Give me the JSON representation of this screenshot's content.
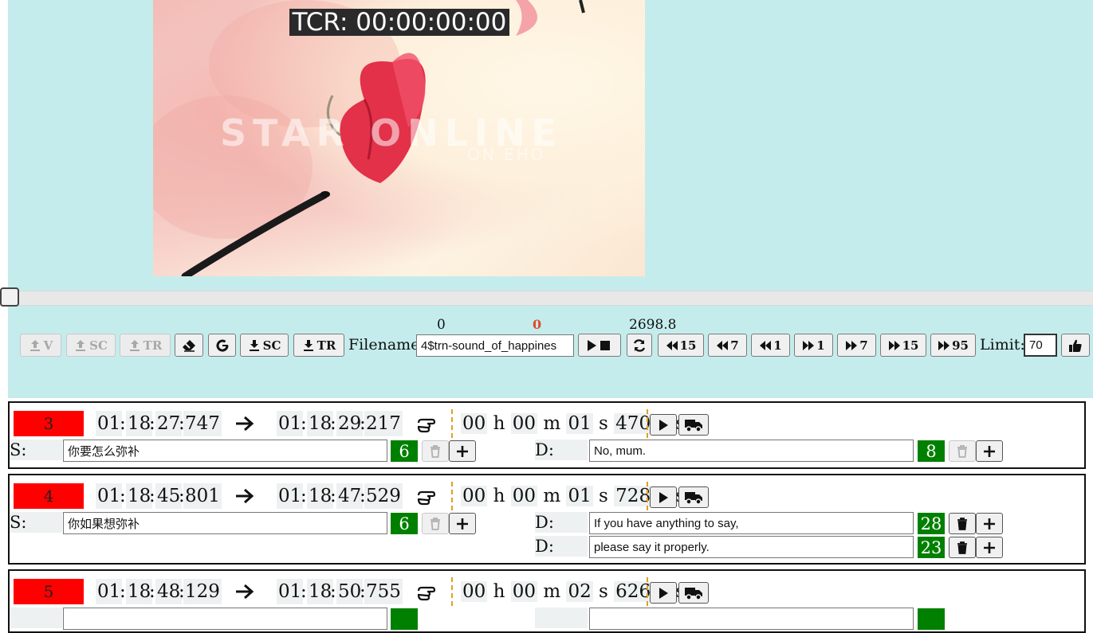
{
  "video": {
    "tcr": "TCR: 00:00:00:00",
    "watermark": "STAR ONLINE",
    "watermark_sub": "ON EHO"
  },
  "positions": {
    "start": "0",
    "current": "0",
    "end": "2698.8"
  },
  "toolbar": {
    "upload_v": "V",
    "upload_sc": "SC",
    "upload_tr": "TR",
    "download_sc": "SC",
    "download_tr": "TR",
    "filename_label": "Filename:",
    "filename_value": "4$trn-sound_of_happines",
    "rew15": "15",
    "rew7": "7",
    "rew1": "1",
    "fwd1": "1",
    "fwd7": "7",
    "fwd15": "15",
    "fwd95": "95",
    "limit_label": "Limit:",
    "limit_value": "70"
  },
  "labels": {
    "source": "S:",
    "dest": "D:",
    "h": "h",
    "m": "m",
    "s": "s",
    "ms": "ms"
  },
  "segments": [
    {
      "num": "3",
      "start": [
        "01",
        "18",
        "27",
        "747"
      ],
      "end": [
        "01",
        "18",
        "29",
        "217"
      ],
      "dur": [
        "00",
        "00",
        "01",
        "470"
      ],
      "source_text": "你要怎么弥补",
      "source_count": "6",
      "dest": [
        {
          "text": "No, mum.",
          "count": "8"
        }
      ]
    },
    {
      "num": "4",
      "start": [
        "01",
        "18",
        "45",
        "801"
      ],
      "end": [
        "01",
        "18",
        "47",
        "529"
      ],
      "dur": [
        "00",
        "00",
        "01",
        "728"
      ],
      "source_text": "你如果想弥补",
      "source_count": "6",
      "dest": [
        {
          "text": "If you have anything to say,",
          "count": "28"
        },
        {
          "text": "please say it properly.",
          "count": "23"
        }
      ]
    },
    {
      "num": "5",
      "start": [
        "01",
        "18",
        "48",
        "129"
      ],
      "end": [
        "01",
        "18",
        "50",
        "755"
      ],
      "dur": [
        "00",
        "00",
        "02",
        "626"
      ]
    }
  ],
  "colors": {
    "panel": "#c5ecec",
    "number_bg": "#ff0000",
    "count_bg": "#008000",
    "dash": "#e0a020"
  }
}
